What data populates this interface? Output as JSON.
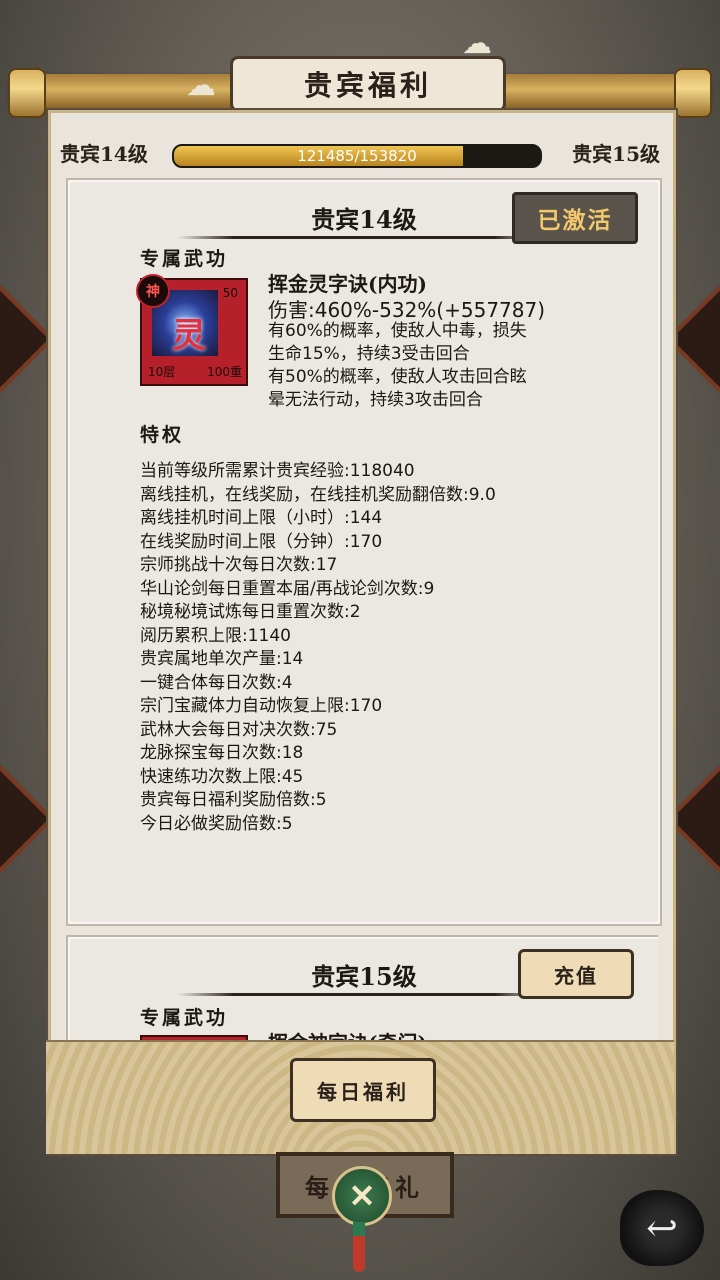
{
  "window": {
    "title": "贵宾福利"
  },
  "progress": {
    "current_level": "贵宾14级",
    "next_level": "贵宾15级",
    "exp_text": "121485/153820",
    "fraction": 0.79
  },
  "cards": [
    {
      "title": "贵宾14级",
      "status": "已激活",
      "exclusive_label": "专属武功",
      "skill": {
        "badge": "神",
        "glyph": "灵",
        "top_num": "50",
        "layer": "10层",
        "weight": "100重",
        "name": "挥金灵字诀(内功)",
        "damage": "伤害:460%-532%(+557787)",
        "desc": [
          "有60%的概率，使敌人中毒，损失",
          "生命15%，持续3受击回合",
          "有50%的概率，使敌人攻击回合眩",
          "晕无法行动，持续3攻击回合"
        ]
      },
      "privilege_label": "特权",
      "privileges": [
        "当前等级所需累计贵宾经验:118040",
        "离线挂机，在线奖励，在线挂机奖励翻倍数:9.0",
        "离线挂机时间上限（小时）:144",
        "在线奖励时间上限（分钟）:170",
        "宗师挑战十次每日次数:17",
        "华山论剑每日重置本届/再战论剑次数:9",
        "秘境秘境试炼每日重置次数:2",
        "阅历累积上限:1140",
        "贵宾属地单次产量:14",
        "一键合体每日次数:4",
        "宗门宝藏体力自动恢复上限:170",
        "武林大会每日对决次数:75",
        "龙脉探宝每日次数:18",
        "快速练功次数上限:45",
        "贵宾每日福利奖励倍数:5",
        "今日必做奖励倍数:5"
      ]
    },
    {
      "title": "贵宾15级",
      "action": "充值",
      "exclusive_label": "专属武功",
      "skill": {
        "name": "挥金神字诀(奇门)"
      }
    }
  ],
  "footer": {
    "daily_button": "每日福利",
    "gift_sign": "每日好礼",
    "close_icon": "crossed-swords-icon",
    "back_icon": "back-arrow-icon"
  }
}
